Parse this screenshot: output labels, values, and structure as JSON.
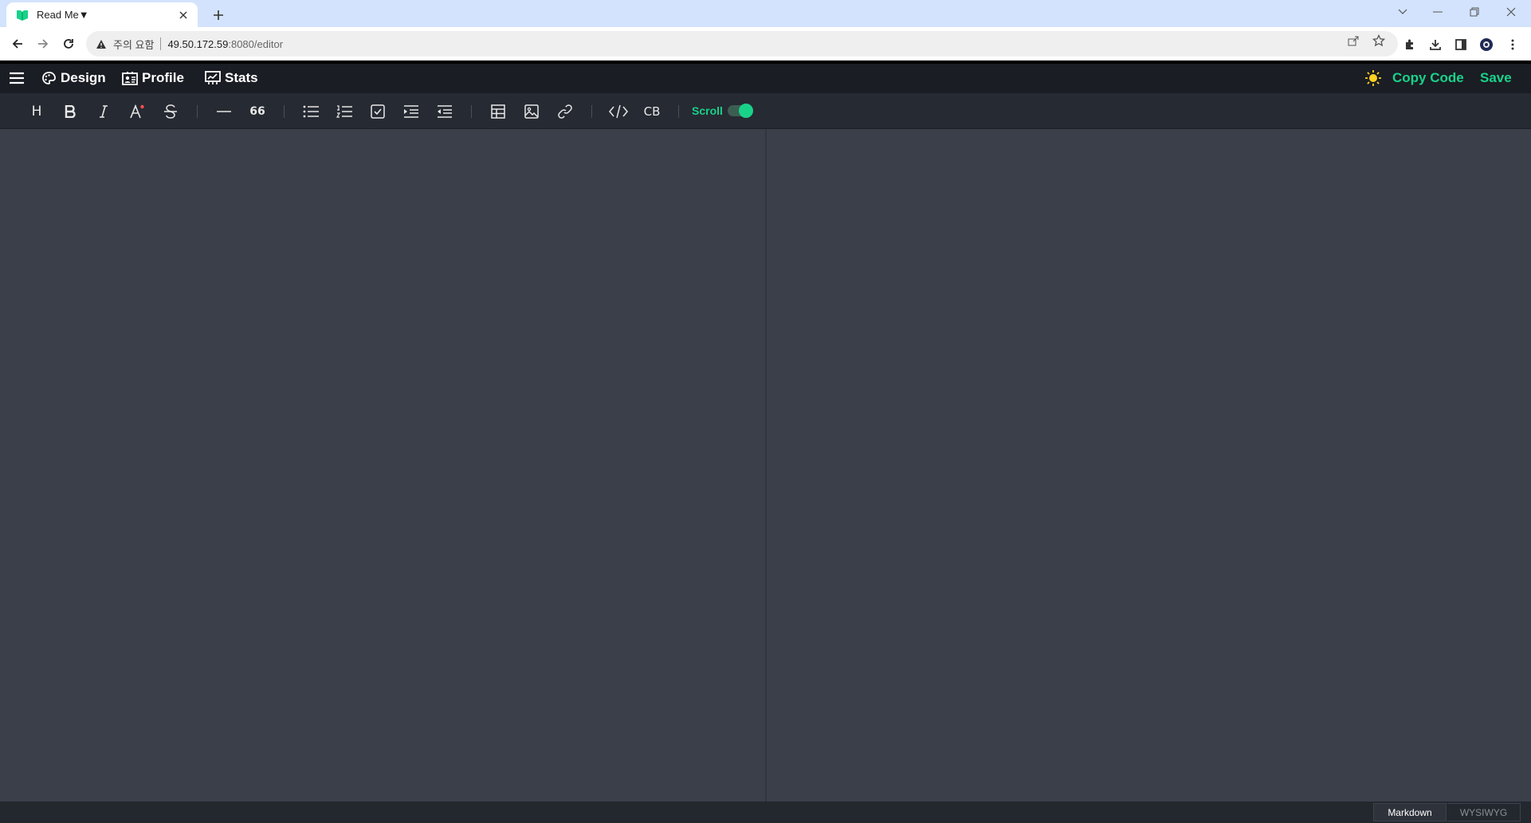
{
  "browser": {
    "tab_title": "Read Me▼",
    "security_warning": "주의 요함",
    "url_host": "49.50.172.59",
    "url_path": ":8080/editor"
  },
  "header": {
    "nav": [
      {
        "label": "Design",
        "icon": "palette-icon"
      },
      {
        "label": "Profile",
        "icon": "profile-card-icon"
      },
      {
        "label": "Stats",
        "icon": "stats-board-icon"
      }
    ],
    "copy_code_label": "Copy Code",
    "save_label": "Save",
    "accent_color": "#19d28a"
  },
  "toolbar": {
    "heading_label": "H",
    "quote_label": "66",
    "codeblock_label": "CB",
    "scroll_label": "Scroll",
    "scroll_sync_on": true
  },
  "modes": {
    "markdown_label": "Markdown",
    "wysiwyg_label": "WYSIWYG",
    "active": "Markdown"
  }
}
